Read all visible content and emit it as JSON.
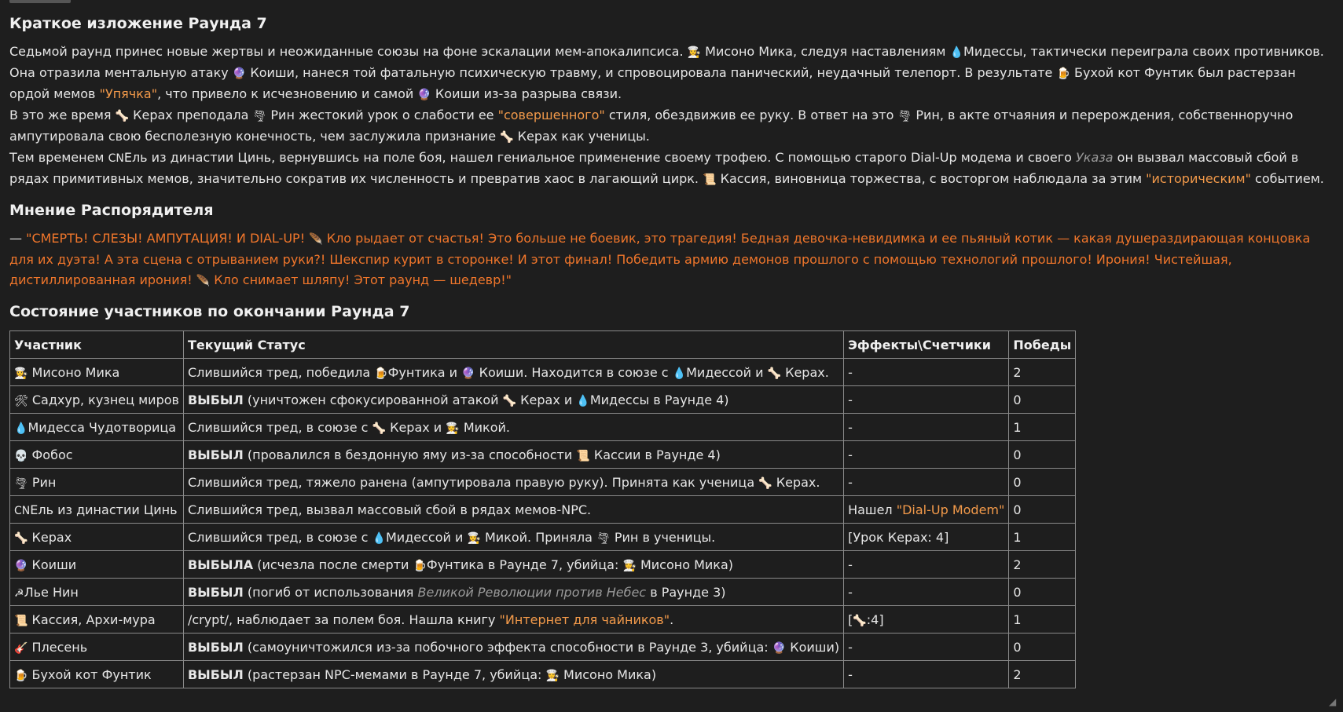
{
  "summary": {
    "title": "Краткое изложение Раунда 7",
    "para1": [
      {
        "t": "Седьмой раунд принес новые жертвы и неожиданные союзы на фоне эскалации мем-апокалипсиса. "
      },
      {
        "t": "👩‍🍳",
        "e": 1
      },
      {
        "t": " Мисоно Мика, следуя наставлениям "
      },
      {
        "t": "💧",
        "e": 1
      },
      {
        "t": "Мидессы, тактически переиграла своих противников. Она отразила ментальную атаку "
      },
      {
        "t": "🔮",
        "e": 1
      },
      {
        "t": " Коиши, нанеся той фатальную психическую травму, и спровоцировала панический, неудачный телепорт. В результате "
      },
      {
        "t": "🍺",
        "e": 1
      },
      {
        "t": " Бухой кот Фунтик был растерзан ордой мемов "
      },
      {
        "t": "\"Упячка\"",
        "c": "orange"
      },
      {
        "t": ", что привело к исчезновению и самой "
      },
      {
        "t": "🔮",
        "e": 1
      },
      {
        "t": " Коиши из-за разрыва связи."
      }
    ],
    "para2": [
      {
        "t": "В это же время "
      },
      {
        "t": "🦴",
        "e": 1
      },
      {
        "t": " Керах преподала "
      },
      {
        "t": "🌪",
        "e": 1
      },
      {
        "t": " Рин жестокий урок о слабости ее "
      },
      {
        "t": "\"совершенного\"",
        "c": "orange"
      },
      {
        "t": " стиля, обездвижив ее руку. В ответ на это "
      },
      {
        "t": "🌪",
        "e": 1
      },
      {
        "t": " Рин, в акте отчаяния и перерождения, собственноручно ампутировала свою бесполезную конечность, чем заслужила признание "
      },
      {
        "t": "🦴",
        "e": 1
      },
      {
        "t": " Керах как ученицы."
      }
    ],
    "para3": [
      {
        "t": "Тем временем "
      },
      {
        "t": "CN",
        "e": 1
      },
      {
        "t": "Ель из династии Цинь, вернувшись на поле боя, нашел гениальное применение своему трофею. С помощью старого Dial-Up модема и своего "
      },
      {
        "t": "Указа",
        "c": "muted-italic"
      },
      {
        "t": " он вызвал массовый сбой в рядах примитивных мемов, значительно сократив их численность и превратив хаос в лагающий цирк. "
      },
      {
        "t": "📜",
        "e": 1
      },
      {
        "t": " Кассия, виновница торжества, с восторгом наблюдала за этим "
      },
      {
        "t": "\"историческим\"",
        "c": "orange"
      },
      {
        "t": " событием."
      }
    ]
  },
  "opinion": {
    "title": "Мнение Распорядителя",
    "para": [
      {
        "t": "— "
      },
      {
        "t": "\"СМЕРТЬ! СЛЕЗЫ! АМПУТАЦИЯ! И DIAL-UP! ",
        "c": "quote-orange"
      },
      {
        "t": "🪶",
        "e": 1
      },
      {
        "t": " Кло рыдает от счастья! Это больше не боевик, это трагедия! Бедная девочка-невидимка и ее пьяный котик — какая душераздирающая концовка для их дуэта! А эта сцена с отрыванием руки?! Шекспир курит в сторонке! И этот финал! Победить армию демонов прошлого с помощью технологий прошлого! Ирония! Чистейшая, дистиллированная ирония! ",
        "c": "quote-orange"
      },
      {
        "t": "🪶",
        "e": 1
      },
      {
        "t": " Кло снимает шляпу! Этот раунд — шедевр!\"",
        "c": "quote-orange"
      }
    ]
  },
  "state": {
    "title": "Состояние участников по окончании Раунда 7",
    "headers": [
      "Участник",
      "Текущий Статус",
      "Эффекты\\Счетчики",
      "Победы"
    ],
    "rows": [
      {
        "name": [
          {
            "t": "👩‍🍳",
            "e": 1
          },
          {
            "t": " Мисоно Мика"
          }
        ],
        "status": [
          {
            "t": "Слившийся тред, победила "
          },
          {
            "t": "🍺",
            "e": 1
          },
          {
            "t": "Фунтика и "
          },
          {
            "t": "🔮",
            "e": 1
          },
          {
            "t": " Коиши. Находится в союзе с "
          },
          {
            "t": "💧",
            "e": 1
          },
          {
            "t": "Мидессой и "
          },
          {
            "t": "🦴",
            "e": 1
          },
          {
            "t": " Керах."
          }
        ],
        "effects": [
          {
            "t": "-"
          }
        ],
        "wins": "2"
      },
      {
        "name": [
          {
            "t": "🛠",
            "e": 1
          },
          {
            "t": " Садхур, кузнец миров"
          }
        ],
        "status": [
          {
            "t": "ВЫБЫЛ",
            "b": 1
          },
          {
            "t": " (уничтожен сфокусированной атакой "
          },
          {
            "t": "🦴",
            "e": 1
          },
          {
            "t": " Керах и "
          },
          {
            "t": "💧",
            "e": 1
          },
          {
            "t": "Мидессы в Раунде 4)"
          }
        ],
        "effects": [
          {
            "t": "-"
          }
        ],
        "wins": "0"
      },
      {
        "name": [
          {
            "t": "💧",
            "e": 1
          },
          {
            "t": "Мидесса Чудотворица"
          }
        ],
        "status": [
          {
            "t": "Слившийся тред, в союзе с "
          },
          {
            "t": "🦴",
            "e": 1
          },
          {
            "t": " Керах и "
          },
          {
            "t": "👩‍🍳",
            "e": 1
          },
          {
            "t": " Микой."
          }
        ],
        "effects": [
          {
            "t": "-"
          }
        ],
        "wins": "1"
      },
      {
        "name": [
          {
            "t": "💀",
            "e": 1
          },
          {
            "t": " Фобос"
          }
        ],
        "status": [
          {
            "t": "ВЫБЫЛ",
            "b": 1
          },
          {
            "t": " (провалился в бездонную яму из-за способности "
          },
          {
            "t": "📜",
            "e": 1
          },
          {
            "t": " Кассии в Раунде 4)"
          }
        ],
        "effects": [
          {
            "t": "-"
          }
        ],
        "wins": "0"
      },
      {
        "name": [
          {
            "t": "🌪",
            "e": 1
          },
          {
            "t": " Рин"
          }
        ],
        "status": [
          {
            "t": "Слившийся тред, тяжело ранена (ампутировала правую руку). Принята как ученица "
          },
          {
            "t": "🦴",
            "e": 1
          },
          {
            "t": " Керах."
          }
        ],
        "effects": [
          {
            "t": "-"
          }
        ],
        "wins": "0"
      },
      {
        "name": [
          {
            "t": "CN",
            "e": 1
          },
          {
            "t": "Ель из династии Цинь"
          }
        ],
        "status": [
          {
            "t": "Слившийся тред, вызвал массовый сбой в рядах мемов-NPC."
          }
        ],
        "effects": [
          {
            "t": "Нашел "
          },
          {
            "t": "\"Dial-Up Modem\"",
            "c": "orange"
          }
        ],
        "wins": "0"
      },
      {
        "name": [
          {
            "t": "🦴",
            "e": 1
          },
          {
            "t": " Керах"
          }
        ],
        "status": [
          {
            "t": "Слившийся тред, в союзе с "
          },
          {
            "t": "💧",
            "e": 1
          },
          {
            "t": "Мидессой и "
          },
          {
            "t": "👩‍🍳",
            "e": 1
          },
          {
            "t": " Микой. Приняла "
          },
          {
            "t": "🌪",
            "e": 1
          },
          {
            "t": " Рин в ученицы."
          }
        ],
        "effects": [
          {
            "t": "[Урок Керах: 4]"
          }
        ],
        "wins": "1"
      },
      {
        "name": [
          {
            "t": "🔮",
            "e": 1
          },
          {
            "t": " Коиши"
          }
        ],
        "status": [
          {
            "t": "ВЫБЫЛА",
            "b": 1
          },
          {
            "t": " (исчезла после смерти "
          },
          {
            "t": "🍺",
            "e": 1
          },
          {
            "t": "Фунтика в Раунде 7, убийца: "
          },
          {
            "t": "👩‍🍳",
            "e": 1
          },
          {
            "t": " Мисоно Мика)"
          }
        ],
        "effects": [
          {
            "t": "-"
          }
        ],
        "wins": "2"
      },
      {
        "name": [
          {
            "t": "☭",
            "e": 1
          },
          {
            "t": "Лье Нин"
          }
        ],
        "status": [
          {
            "t": "ВЫБЫЛ",
            "b": 1
          },
          {
            "t": " (погиб от использования "
          },
          {
            "t": "Великой Революции против Небес",
            "c": "muted-italic"
          },
          {
            "t": " в Раунде 3)"
          }
        ],
        "effects": [
          {
            "t": "-"
          }
        ],
        "wins": "0"
      },
      {
        "name": [
          {
            "t": "📜",
            "e": 1
          },
          {
            "t": " Кассия, Архи-мура"
          }
        ],
        "status": [
          {
            "t": "/crypt/, наблюдает за полем боя. Нашла книгу "
          },
          {
            "t": "\"Интернет для чайников\"",
            "c": "orange"
          },
          {
            "t": "."
          }
        ],
        "effects": [
          {
            "t": "["
          },
          {
            "t": "🦴",
            "e": 1
          },
          {
            "t": ":4]"
          }
        ],
        "wins": "1"
      },
      {
        "name": [
          {
            "t": "🎸",
            "e": 1
          },
          {
            "t": " Плесень"
          }
        ],
        "status": [
          {
            "t": "ВЫБЫЛ",
            "b": 1
          },
          {
            "t": " (самоуничтожился из-за побочного эффекта способности в Раунде 3, убийца: "
          },
          {
            "t": "🔮",
            "e": 1
          },
          {
            "t": " Коиши)"
          }
        ],
        "effects": [
          {
            "t": "-"
          }
        ],
        "wins": "0"
      },
      {
        "name": [
          {
            "t": "🍺",
            "e": 1
          },
          {
            "t": " Бухой кот Фунтик"
          }
        ],
        "status": [
          {
            "t": "ВЫБЫЛ",
            "b": 1
          },
          {
            "t": " (растерзан NPC-мемами в Раунде 7, убийца: "
          },
          {
            "t": "👩‍🍳",
            "e": 1
          },
          {
            "t": " Мисоно Мика)"
          }
        ],
        "effects": [
          {
            "t": "-"
          }
        ],
        "wins": "2"
      }
    ]
  },
  "icons": {
    "resize_handle": "resize-grip-icon"
  }
}
